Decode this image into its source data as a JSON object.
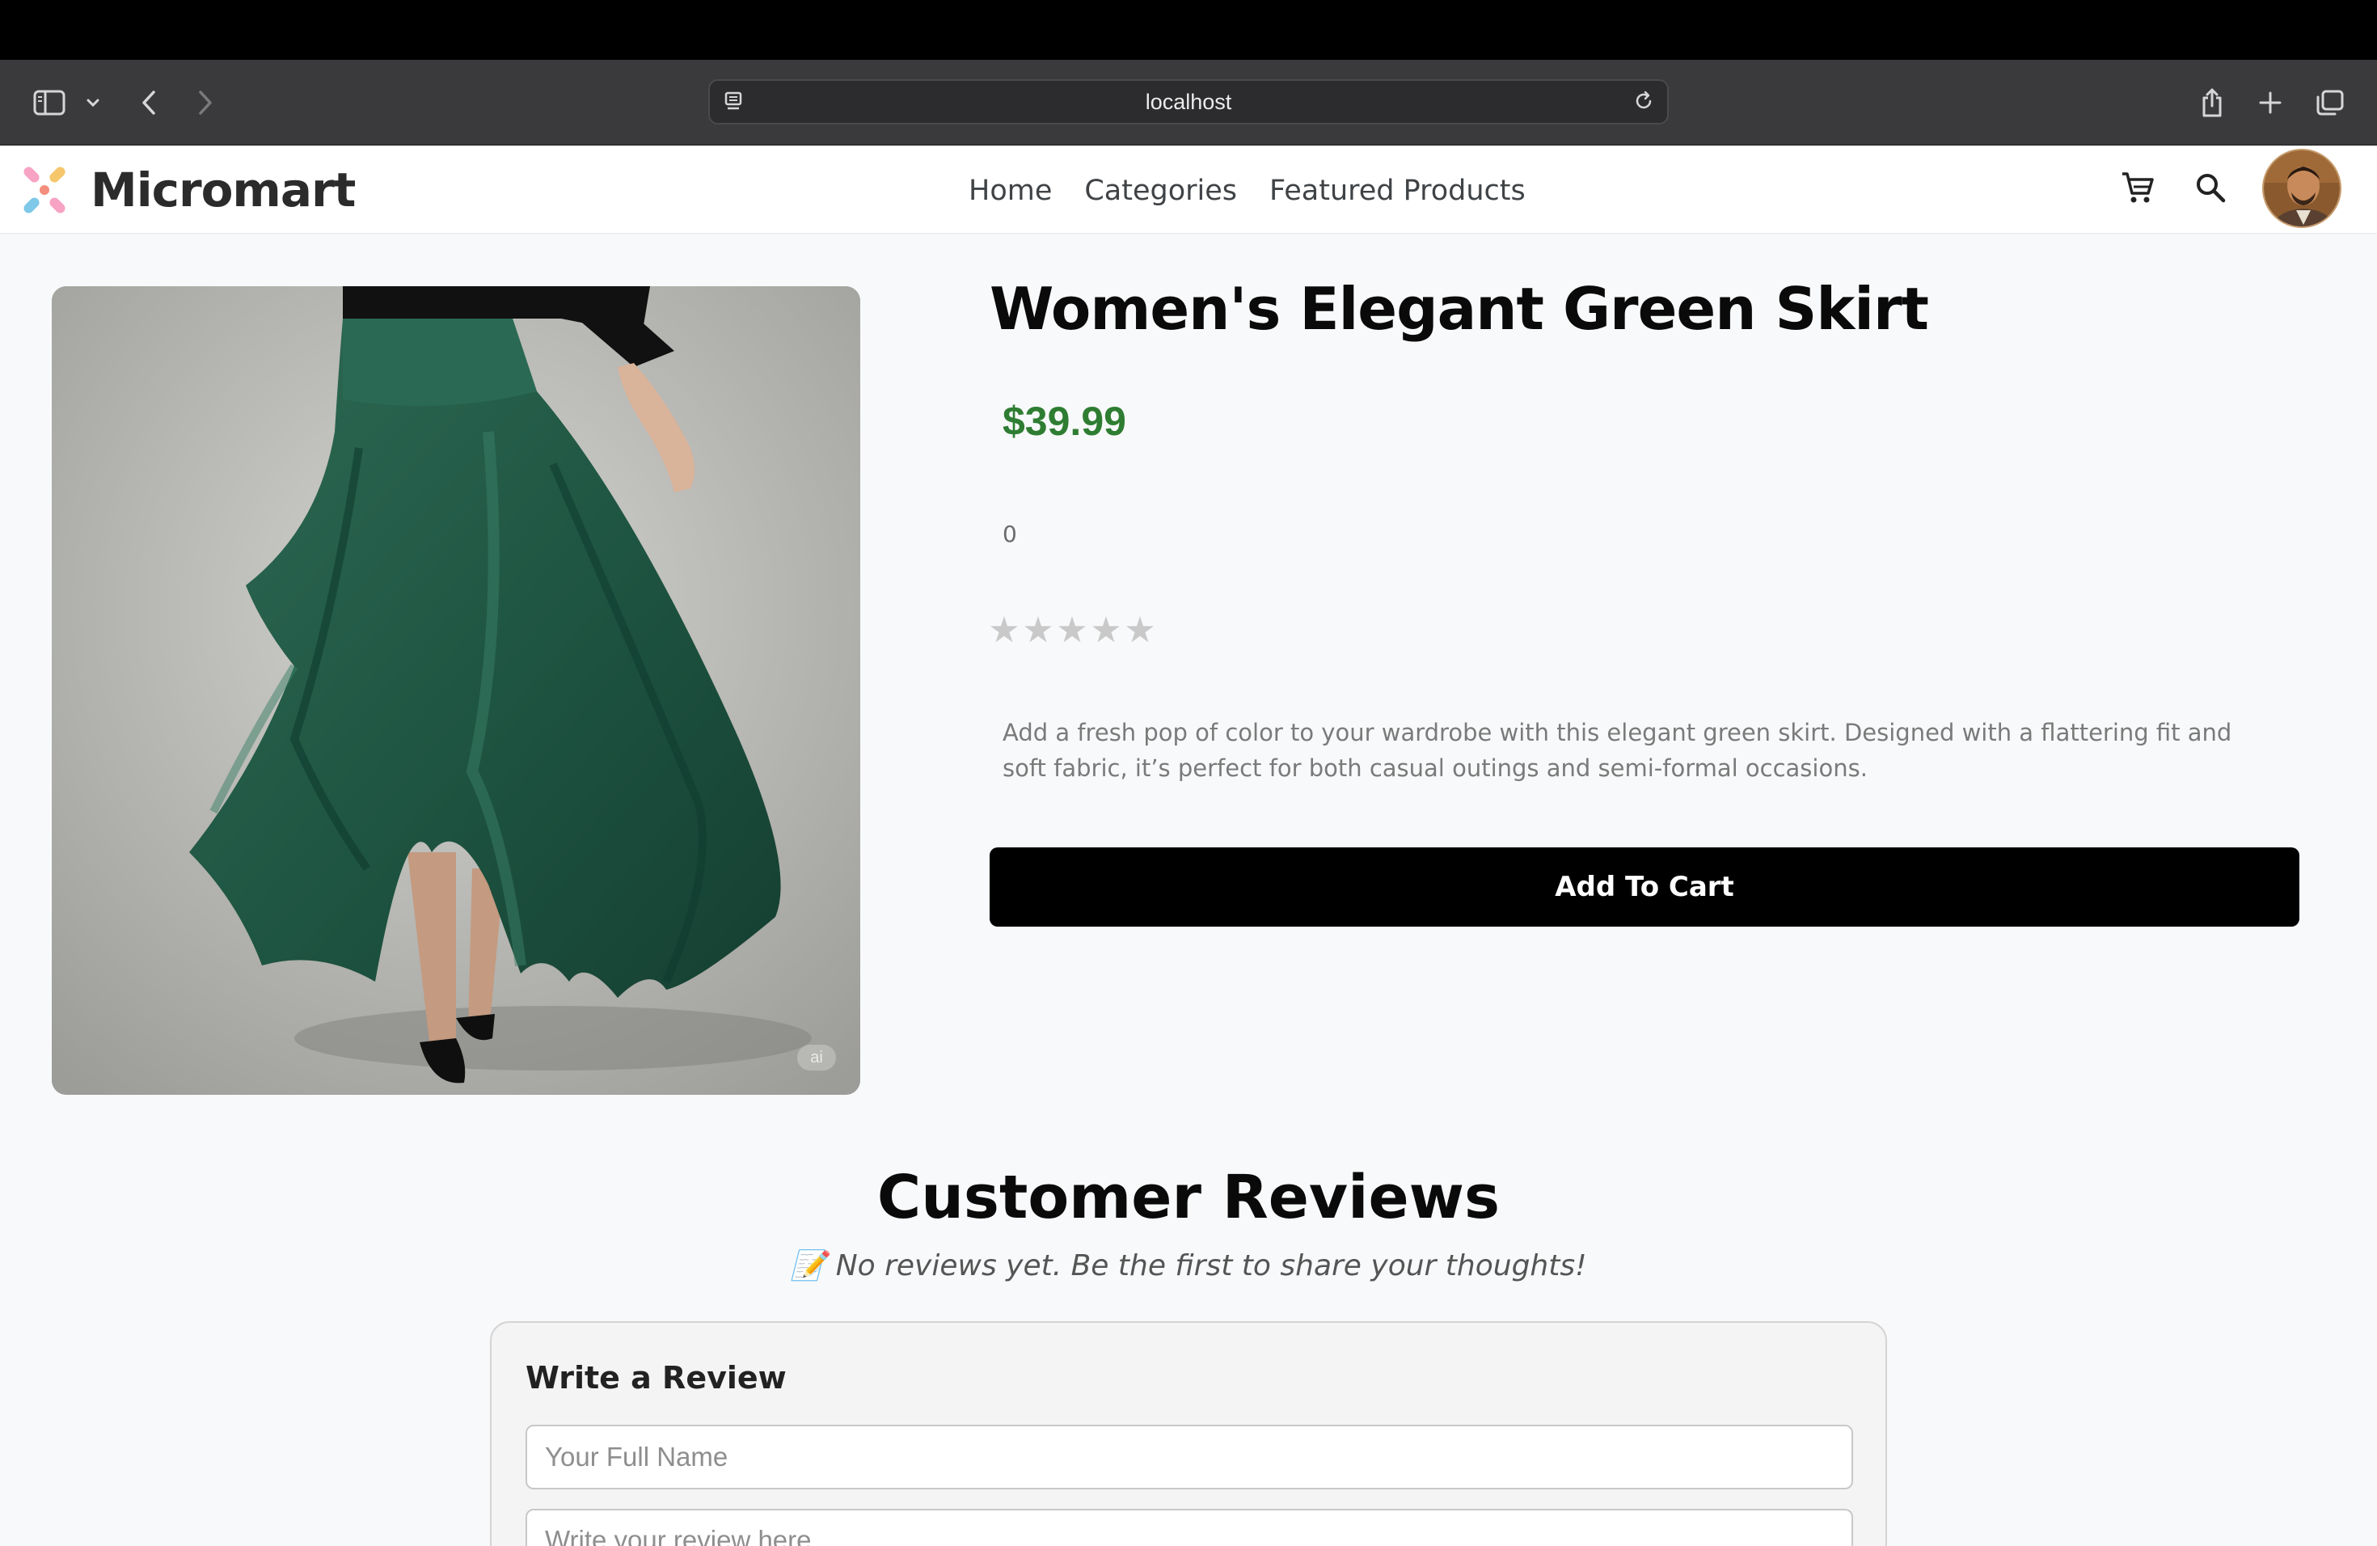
{
  "browser": {
    "url": "localhost"
  },
  "header": {
    "brand": "Micromart",
    "nav": [
      "Home",
      "Categories",
      "Featured Products"
    ]
  },
  "product": {
    "title": "Women's Elegant Green Skirt",
    "price": "$39.99",
    "rating_count": "0",
    "rating": 0,
    "rating_max": 5,
    "description": "Add a fresh pop of color to your wardrobe with this elegant green skirt. Designed with a flattering fit and soft fabric, it’s perfect for both casual outings and semi-formal occasions.",
    "add_to_cart_label": "Add To Cart",
    "image_badge": "ai"
  },
  "reviews": {
    "title": "Customer Reviews",
    "empty_message": "📝 No reviews yet. Be the first to share your thoughts!",
    "form": {
      "heading": "Write a Review",
      "name_placeholder": "Your Full Name",
      "review_placeholder": "Write your review here..."
    }
  },
  "colors": {
    "price": "#2e7d32",
    "button": "#000000",
    "star_empty": "#c9c9c9"
  },
  "icons": [
    "sidebar-icon",
    "chevron-down-icon",
    "back-icon",
    "forward-icon",
    "site-settings-icon",
    "reload-icon",
    "share-icon",
    "new-tab-icon",
    "tabs-overview-icon",
    "cart-icon",
    "search-icon"
  ]
}
